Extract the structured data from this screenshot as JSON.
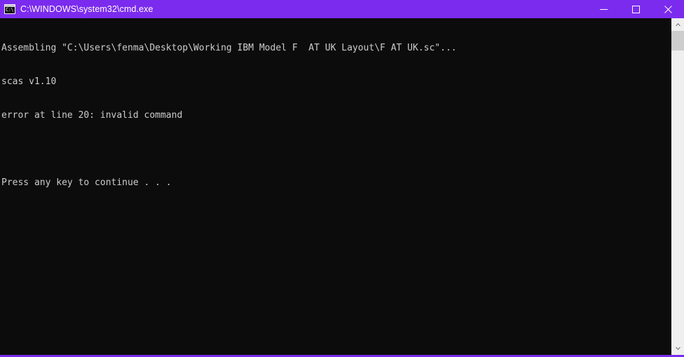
{
  "window": {
    "title": "C:\\WINDOWS\\system32\\cmd.exe",
    "icon_name": "cmd-icon",
    "icon_text": "C:\\",
    "titlebar_color": "#7b2bee",
    "background_color": "#0c0c0c",
    "text_color": "#cccccc",
    "controls": {
      "minimize_label": "Minimize",
      "maximize_label": "Maximize",
      "close_label": "Close"
    }
  },
  "console": {
    "lines": [
      "Assembling \"C:\\Users\\fenma\\Desktop\\Working IBM Model F  AT UK Layout\\F AT UK.sc\"...",
      "scas v1.10",
      "error at line 20: invalid command",
      "",
      "Press any key to continue . . ."
    ]
  },
  "scrollbar": {
    "up_arrow_name": "scroll-up-arrow",
    "down_arrow_name": "scroll-down-arrow",
    "track_color": "#efefef",
    "thumb_color": "#cdcdcd"
  }
}
